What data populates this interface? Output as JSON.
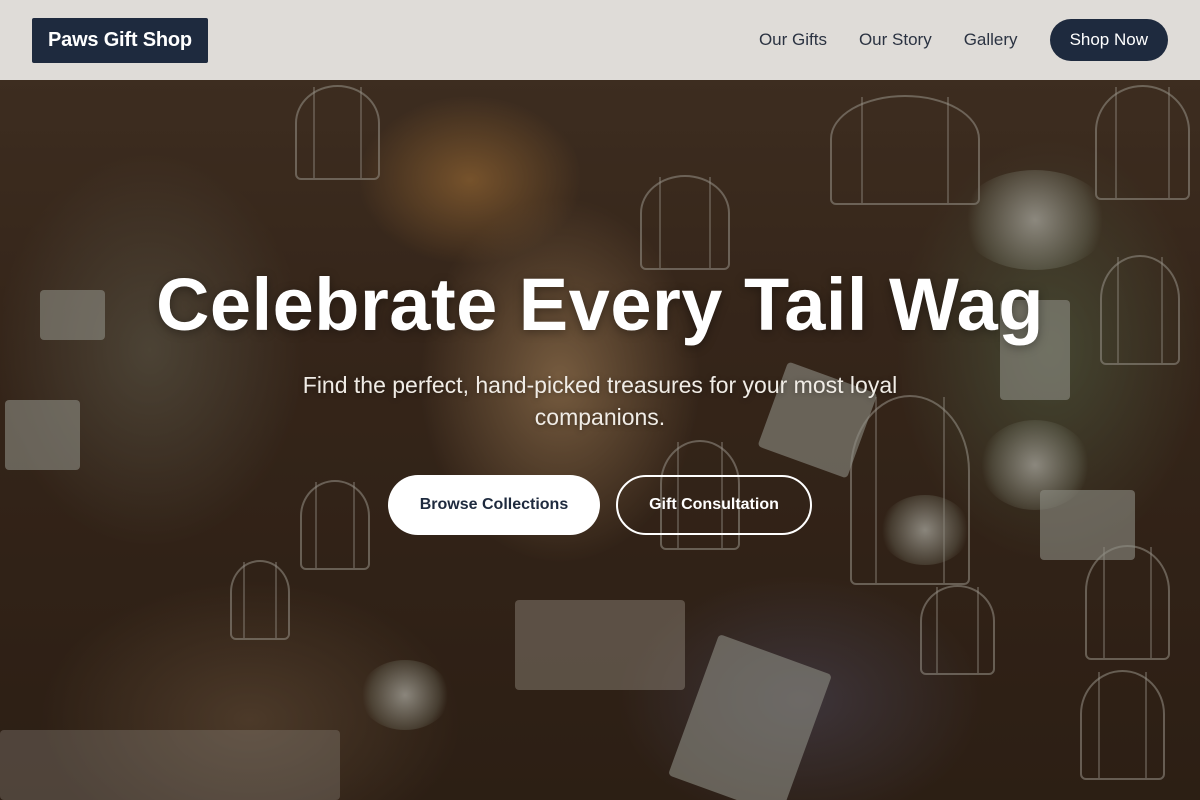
{
  "header": {
    "brand": "Paws Gift Shop",
    "nav": [
      {
        "label": "Our Gifts"
      },
      {
        "label": "Our Story"
      },
      {
        "label": "Gallery"
      }
    ],
    "cta_label": "Shop Now"
  },
  "hero": {
    "title": "Celebrate Every Tail Wag",
    "subtitle": "Find the perfect, hand-picked treasures for your most loyal companions.",
    "primary_button": "Browse Collections",
    "secondary_button": "Gift Consultation",
    "background_image": "gift shop interior with hanging birdcages, flowers and watering cans"
  },
  "colors": {
    "brand_navy": "#1e2a3e",
    "header_bg": "#eceae6",
    "hero_text": "#ffffff"
  }
}
